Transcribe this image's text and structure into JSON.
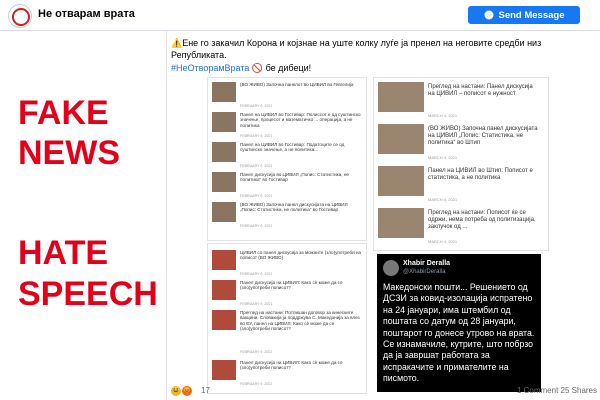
{
  "header": {
    "page_name": "Не отварам врата",
    "send_label": "Send Message"
  },
  "sidebar": {
    "fake": "FAKE",
    "news": "NEWS",
    "hate": "HATE",
    "speech": "SPEECH"
  },
  "post": {
    "text": "⚠️Ене го закачил Корона и којзнае на уште колку луѓе ја пренел на неговите средби низ Републиката.",
    "hashtag": "#НеОтворамВрата",
    "after_hashtag": "🚫 бе дибеци!"
  },
  "left_column": [
    {
      "text": "(ВО ЖИВО) Започна панелот во ЦИВИЛ во Гевгелија",
      "date": "FEBRUARY 9, 2021"
    },
    {
      "text": "Панел на ЦИВИЛ во Гостивар: Полиссот е од суштинско значење, процесот и математичко ... операција, а не политика",
      "date": "FEBRUARY 9, 2021"
    },
    {
      "text": "Панел на ЦИВИЛ во Гостивар: Податоците се од суштинско значење, а не политика...",
      "date": "FEBRUARY 9, 2021"
    },
    {
      "text": "Панел дискусија во ЦИВИЛ „Попис: Статистика, не политика“ во Гостивар",
      "date": "FEBRUARY 9, 2021"
    },
    {
      "text": "(ВО ЖИВО) Започна панел дискусијата на ЦИВИЛ „Попис: Статистика, не политика“ во Гостивар",
      "date": "FEBRUARY 9, 2021"
    },
    {
      "text": "ЦИВИЛ со панел дискусија за можните (зло)употреби на пописот (ВО ЖИВО)",
      "date": "FEBRUARY 9, 2021"
    },
    {
      "text": "Панел дискусија на ЦИВИЛ: Како сѐ може да се (зло)употреби пописот?",
      "date": "FEBRUARY 9, 2021"
    },
    {
      "text": "Преглед на настани: Потпишан договор за кинеските вакцини, Словакија ја поддржува С. Македонија за влез во ЕУ, панел на ЦИВИЛ: Како сѐ може да се (зло)употреби пописот?",
      "date": "FEBRUARY 9, 2021"
    },
    {
      "text": "Панел дискусија на ЦИВИЛ: Како сѐ може да се (зло)употреби пописот?",
      "date": "FEBRUARY 9, 2021"
    }
  ],
  "right_column": [
    {
      "text": "Преглед на настани: Панел дискусија на ЦИВИЛ – пописот е нужност",
      "date": "MARCH 4, 2021"
    },
    {
      "text": "(ВО ЖИВО) Започна панел дискусијата на ЦИВИЛ „Попис: Статистика, не политика“ во Штип",
      "date": "MARCH 4, 2021"
    },
    {
      "text": "Панел на ЦИВИЛ во Штип: Пописот е статистика, а не политика",
      "date": "MARCH 4, 2021"
    },
    {
      "text": "Преглед на настани: Пописот ќе се одржи, нема потреба од политизација, заклучок од ...",
      "date": "MARCH 4, 2021"
    }
  ],
  "tweet": {
    "name": "Xhabir Deralla",
    "handle": "@XhabirDeralla",
    "body": "Македонски пошти... Решението од ДСЗИ за ковид-изолација испратено на 24 јануари, има штембил од поштата со датум од 28 јануари, поштарот го донесе утрово на врата. Се изнамачиле, кутрите, што побрзо да ја завршат работата за испракачите и примателите на писмото."
  },
  "footer": {
    "reaction_count": "17",
    "comments": "1 Comment",
    "shares": "25 Shares"
  },
  "colors": {
    "brand": "#1877f2",
    "alert": "#e3001b",
    "tweet_bg": "#000000"
  }
}
